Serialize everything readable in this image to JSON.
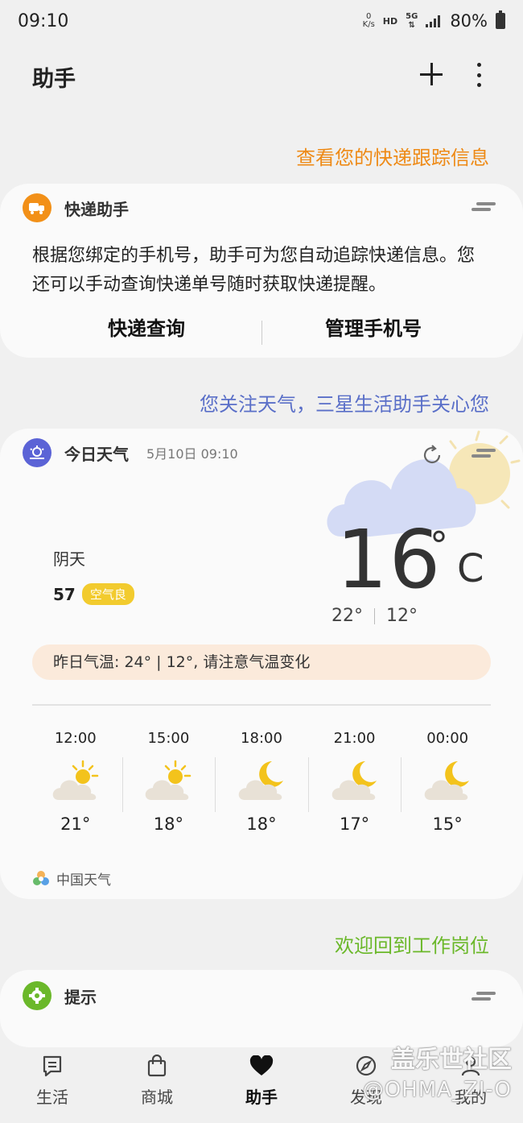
{
  "status_bar": {
    "time": "09:10",
    "net_speed_value": "0",
    "net_speed_unit": "K/s",
    "hd": "HD",
    "network": "5G",
    "battery": "80%"
  },
  "header": {
    "title": "助手",
    "add_icon": "plus-icon",
    "more_icon": "more-vertical-icon"
  },
  "express": {
    "caption": "查看您的快递跟踪信息",
    "caption_color": "#ee8a16",
    "card_title": "快递助手",
    "description": "根据您绑定的手机号，助手可为您自动追踪快递信息。您还可以手动查询快递单号随时获取快递提醒。",
    "action_query": "快递查询",
    "action_manage": "管理手机号",
    "icon_color": "#f29018"
  },
  "weather": {
    "caption": "您关注天气，三星生活助手关心您",
    "caption_color": "#5a6fc8",
    "card_title": "今日天气",
    "date": "5月10日 09:10",
    "icon_color": "#5b63d6",
    "temperature": "16",
    "unit_degree": "°",
    "unit_c": "C",
    "high": "22°",
    "low": "12°",
    "condition": "阴天",
    "aqi_value": "57",
    "aqi_label": "空气良",
    "yesterday": "昨日气温: 24° | 12°, 请注意气温变化",
    "hourly": [
      {
        "time": "12:00",
        "temp": "21°",
        "icon": "partly-sunny-icon"
      },
      {
        "time": "15:00",
        "temp": "18°",
        "icon": "partly-sunny-icon"
      },
      {
        "time": "18:00",
        "temp": "18°",
        "icon": "partly-cloudy-night-icon"
      },
      {
        "time": "21:00",
        "temp": "17°",
        "icon": "partly-cloudy-night-icon"
      },
      {
        "time": "00:00",
        "temp": "15°",
        "icon": "partly-cloudy-night-icon"
      }
    ],
    "source": "中国天气"
  },
  "tips": {
    "caption": "欢迎回到工作岗位",
    "caption_color": "#6bb82a",
    "card_title": "提示",
    "icon_color": "#6bb82a"
  },
  "bottom_nav": {
    "items": [
      {
        "label": "生活",
        "icon": "life-icon"
      },
      {
        "label": "商城",
        "icon": "shopping-bag-icon"
      },
      {
        "label": "助手",
        "icon": "heart-icon",
        "active": true
      },
      {
        "label": "发现",
        "icon": "compass-icon"
      },
      {
        "label": "我的",
        "icon": "person-icon"
      }
    ]
  },
  "watermark": {
    "line1": "盖乐世社区",
    "line2": "@OHMA_ZI-O"
  }
}
